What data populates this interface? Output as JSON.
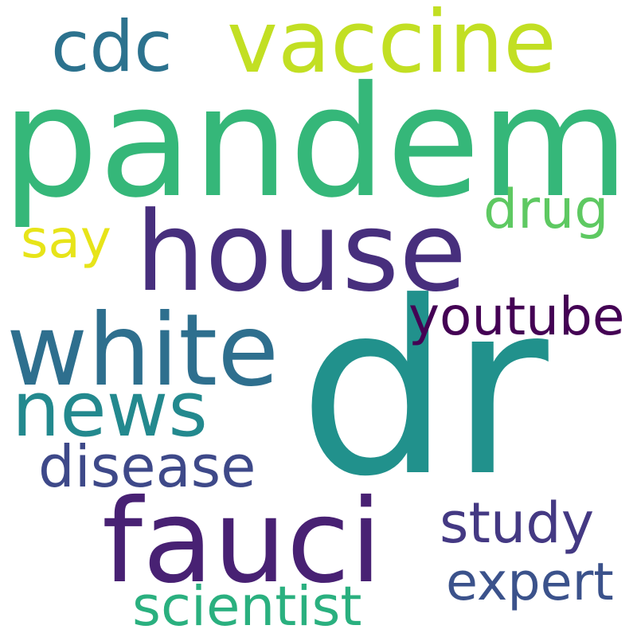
{
  "words": [
    {
      "text": "pandemic",
      "color": "#35b779"
    },
    {
      "text": "house",
      "color": "#472f7d"
    },
    {
      "text": "white",
      "color": "#2e6f8e"
    },
    {
      "text": "dr",
      "color": "#21918c"
    },
    {
      "text": "fauci",
      "color": "#482173"
    },
    {
      "text": "vaccine",
      "color": "#c2df23"
    },
    {
      "text": "cdc",
      "color": "#2c728e"
    },
    {
      "text": "news",
      "color": "#23898e"
    },
    {
      "text": "youtube",
      "color": "#440154"
    },
    {
      "text": "disease",
      "color": "#3e4989"
    },
    {
      "text": "drug",
      "color": "#5ec962"
    },
    {
      "text": "say",
      "color": "#e7e419"
    },
    {
      "text": "study",
      "color": "#443983"
    },
    {
      "text": "expert",
      "color": "#3b528b"
    },
    {
      "text": "scientist",
      "color": "#2ab07f"
    }
  ]
}
